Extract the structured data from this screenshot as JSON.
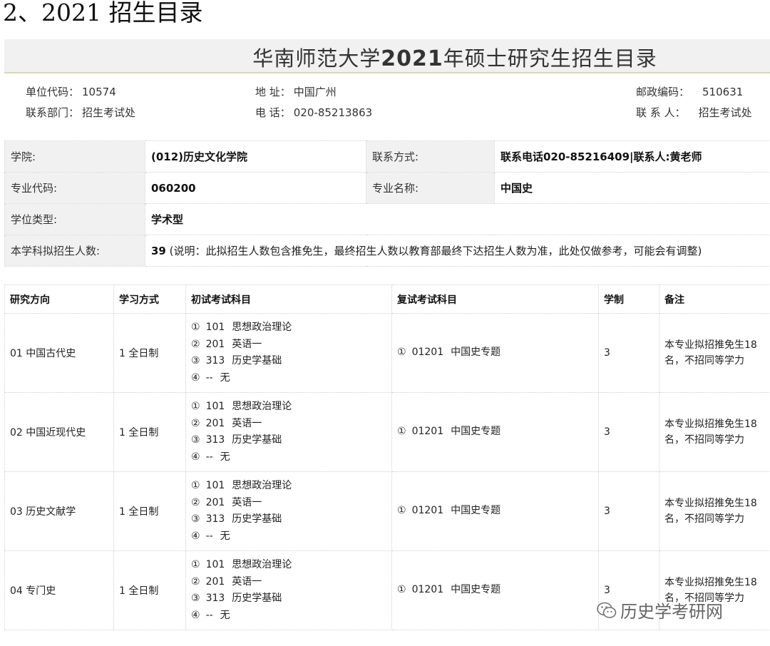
{
  "heading": "2、2021 招生目录",
  "banner": {
    "title_pre": "华南师范大学",
    "title_year": "2021",
    "title_post": "年硕士研究生招生目录"
  },
  "info": {
    "unit_code_label": "单位代码：",
    "unit_code": "10574",
    "department_label": "联系部门：",
    "department": "招生考试处",
    "address_label": "地 址：",
    "address": "中国广州",
    "phone_label": "电 话：",
    "phone": "020-85213863",
    "postcode_label": "邮政编码：",
    "postcode": "510631",
    "contact_label": "联 系 人：",
    "contact": "招生考试处"
  },
  "meta": {
    "college_label": "学院:",
    "college": "(012)历史文化学院",
    "contact_way_label": "联系方式:",
    "contact_way": "联系电话020-85216409|联系人:黄老师",
    "major_code_label": "专业代码:",
    "major_code": "060200",
    "major_name_label": "专业名称:",
    "major_name": "中国史",
    "degree_type_label": "学位类型:",
    "degree_type": "学术型",
    "quota_label": "本学科拟招生人数:",
    "quota": "39",
    "quota_note": " (说明：此拟招生人数包含推免生，最终招生人数以教育部最终下达招生人数为准，此处仅做参考，可能会有调整)"
  },
  "table": {
    "headers": [
      "研究方向",
      "学习方式",
      "初试考试科目",
      "复试考试科目",
      "学制",
      "备注"
    ],
    "rows": [
      {
        "direction": "01 中国古代史",
        "mode": "1 全日制",
        "exam": [
          {
            "n": "①",
            "code": "101",
            "name": "思想政治理论"
          },
          {
            "n": "②",
            "code": "201",
            "name": "英语一"
          },
          {
            "n": "③",
            "code": "313",
            "name": "历史学基础"
          },
          {
            "n": "④",
            "code": "--",
            "name": "无"
          }
        ],
        "retest": {
          "n": "①",
          "code": "01201",
          "name": "中国史专题"
        },
        "years": "3",
        "remark": "本专业拟招推免生18名，不招同等学力"
      },
      {
        "direction": "02 中国近现代史",
        "mode": "1 全日制",
        "exam": [
          {
            "n": "①",
            "code": "101",
            "name": "思想政治理论"
          },
          {
            "n": "②",
            "code": "201",
            "name": "英语一"
          },
          {
            "n": "③",
            "code": "313",
            "name": "历史学基础"
          },
          {
            "n": "④",
            "code": "--",
            "name": "无"
          }
        ],
        "retest": {
          "n": "①",
          "code": "01201",
          "name": "中国史专题"
        },
        "years": "3",
        "remark": "本专业拟招推免生18名，不招同等学力"
      },
      {
        "direction": "03 历史文献学",
        "mode": "1 全日制",
        "exam": [
          {
            "n": "①",
            "code": "101",
            "name": "思想政治理论"
          },
          {
            "n": "②",
            "code": "201",
            "name": "英语一"
          },
          {
            "n": "③",
            "code": "313",
            "name": "历史学基础"
          },
          {
            "n": "④",
            "code": "--",
            "name": "无"
          }
        ],
        "retest": {
          "n": "①",
          "code": "01201",
          "name": "中国史专题"
        },
        "years": "3",
        "remark": "本专业拟招推免生18名，不招同等学力"
      },
      {
        "direction": "04 专门史",
        "mode": "1 全日制",
        "exam": [
          {
            "n": "①",
            "code": "101",
            "name": "思想政治理论"
          },
          {
            "n": "②",
            "code": "201",
            "name": "英语一"
          },
          {
            "n": "③",
            "code": "313",
            "name": "历史学基础"
          },
          {
            "n": "④",
            "code": "--",
            "name": "无"
          }
        ],
        "retest": {
          "n": "①",
          "code": "01201",
          "name": "中国史专题"
        },
        "years": "3",
        "remark": "本专业拟招推免生18名，不招同等学力"
      }
    ]
  },
  "watermark": {
    "text": "历史学考研网",
    "icon": "wechat-icon"
  }
}
